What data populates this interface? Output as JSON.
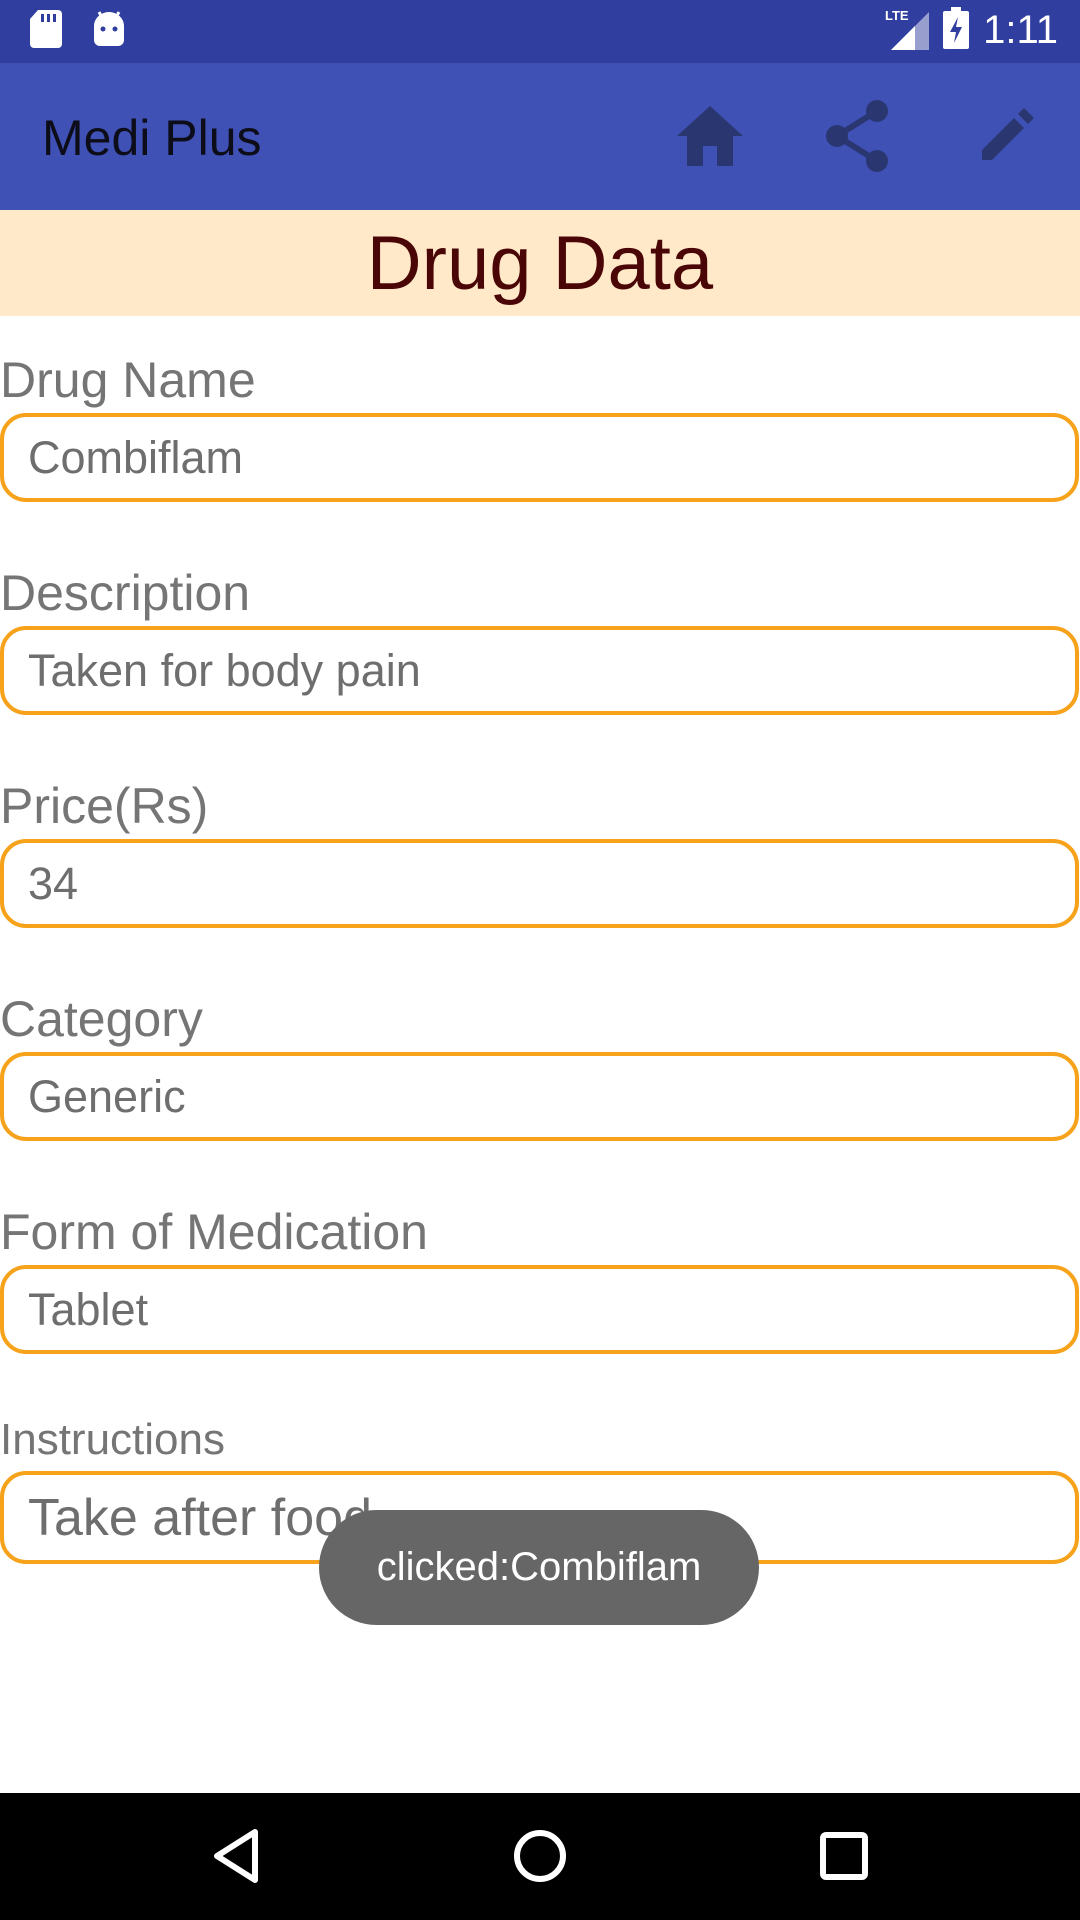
{
  "status_bar": {
    "time": "1:11",
    "network": "LTE",
    "icons": [
      "sd-card-icon",
      "android-icon",
      "signal-icon",
      "battery-charging-icon"
    ]
  },
  "app_bar": {
    "title": "Medi Plus",
    "actions": [
      "home-icon",
      "share-icon",
      "edit-icon"
    ]
  },
  "header": {
    "title": "Drug Data"
  },
  "fields": [
    {
      "label": "Drug Name",
      "value": "Combiflam"
    },
    {
      "label": "Description",
      "value": "Taken for body pain"
    },
    {
      "label": "Price(Rs)",
      "value": "34"
    },
    {
      "label": "Category",
      "value": "Generic"
    },
    {
      "label": "Form of Medication",
      "value": "Tablet"
    },
    {
      "label": "Instructions",
      "value": "Take after food"
    }
  ],
  "toast": {
    "text": "clicked:Combiflam"
  },
  "nav_bar": {
    "buttons": [
      "back-icon",
      "home-circle-icon",
      "recents-icon"
    ]
  },
  "colors": {
    "status_bar": "#303f9f",
    "app_bar": "#3f51b5",
    "banner": "#ffe9c9",
    "banner_text": "#4a0606",
    "field_border": "#f7a21b"
  }
}
